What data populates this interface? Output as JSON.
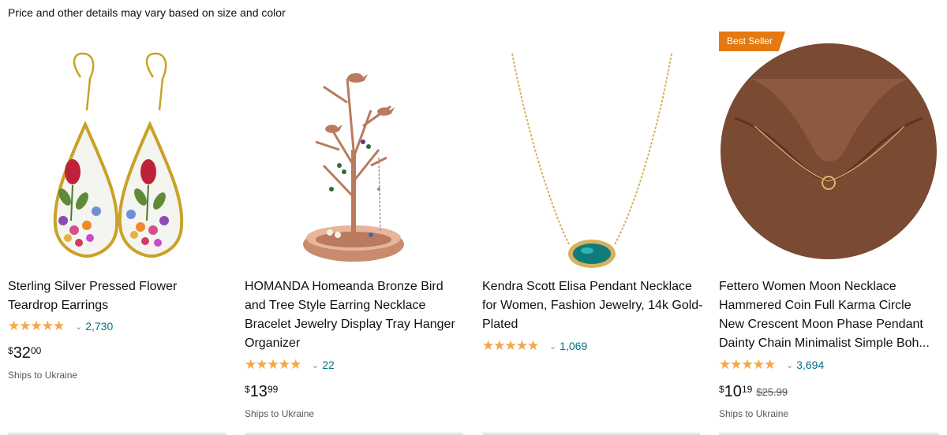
{
  "notice": "Price and other details may vary based on size and color",
  "colors": {
    "badge": "#e47911",
    "star": "#f3a847",
    "link": "#007185"
  },
  "products": [
    {
      "title": "Sterling Silver Pressed Flower Teardrop Earrings",
      "rating": 4.5,
      "stars_icon": "star-rating-icon",
      "reviews": "2,730",
      "price": {
        "symbol": "$",
        "whole": "32",
        "fraction": "00"
      },
      "ships": "Ships to Ukraine"
    },
    {
      "title": "HOMANDA Homeanda Bronze Bird and Tree Style Earring Necklace Bracelet Jewelry Display Tray Hanger Organizer",
      "rating": 4.5,
      "stars_icon": "star-rating-icon",
      "reviews": "22",
      "price": {
        "symbol": "$",
        "whole": "13",
        "fraction": "99"
      },
      "ships": "Ships to Ukraine"
    },
    {
      "title": "Kendra Scott Elisa Pendant Necklace for Women, Fashion Jewelry, 14k Gold-Plated",
      "rating": 4.5,
      "stars_icon": "star-rating-icon",
      "reviews": "1,069"
    },
    {
      "badge": "Best Seller",
      "title_lines": [
        "Fettero Women Moon Necklace",
        "Hammered Coin Full Karma Circle",
        "New Crescent Moon Phase Pendant",
        "Dainty Chain Minimalist Simple Boh..."
      ],
      "rating": 4.5,
      "stars_icon": "star-rating-icon",
      "reviews": "3,694",
      "price": {
        "symbol": "$",
        "whole": "10",
        "fraction": "19",
        "was": "$25.99"
      },
      "ships": "Ships to Ukraine"
    }
  ]
}
